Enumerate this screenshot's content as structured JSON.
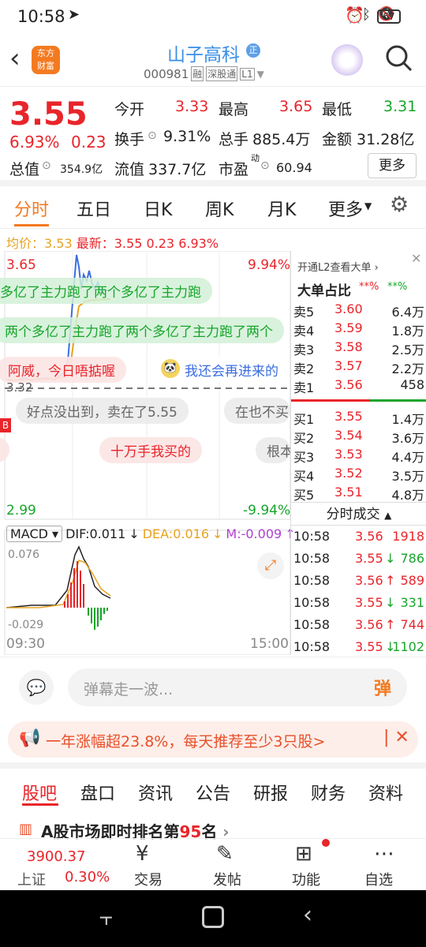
{
  "statusbar": {
    "time": "10:58",
    "battery": "67"
  },
  "header": {
    "title": "山子高科",
    "title_badge": "正",
    "code": "000981",
    "tags": [
      "融",
      "深股通",
      "L1"
    ]
  },
  "quote": {
    "price": "3.55",
    "change_pct": "6.93%",
    "change": "0.23",
    "open_label": "今开",
    "open": "3.33",
    "high_label": "最高",
    "high": "3.65",
    "low_label": "最低",
    "low": "3.31",
    "turnover_label": "换手",
    "turnover": "9.31%",
    "volume_label": "总手",
    "volume": "885.4万",
    "amount_label": "金额",
    "amount": "31.28亿",
    "mcap_label": "总值",
    "mcap": "354.9亿",
    "float_label": "流值",
    "float": "337.7亿",
    "pe_label": "市盈",
    "pe_sup": "动",
    "pe": "60.94",
    "more": "更多"
  },
  "tabs": [
    "分时",
    "五日",
    "日K",
    "周K",
    "月K",
    "更多"
  ],
  "chart": {
    "avg_label": "均价：",
    "avg": "3.53",
    "latest_label": "最新：",
    "latest": "3.55",
    "latest_chg": "0.23",
    "latest_pct": "6.93%",
    "top_price": "3.65",
    "top_pct": "9.94%",
    "bot_price": "2.99",
    "bot_pct": "-9.94%",
    "pre_close": "3.32",
    "macd_label": "MACD",
    "dif": "DIF:0.011",
    "dea": "DEA:0.016",
    "m": "M:-0.009",
    "macd_top": "0.076",
    "macd_bot": "-0.029",
    "t_start": "09:30",
    "t_end": "15:00"
  },
  "danmu": [
    "多亿了主力跑了两个多亿了主力跑",
    "两个多亿了主力跑了两个多亿了主力跑了两个",
    "阿威，今日唔掂喔",
    "我还会再进来的",
    "好点没出到，卖在了5.55",
    "在也不买",
    "十万手我买的",
    "根本"
  ],
  "side": {
    "l2": "开通L2查看大单",
    "big_label": "大单占比",
    "big_a": "**%",
    "big_b": "**%",
    "asks": [
      {
        "l": "卖5",
        "p": "3.60",
        "v": "6.4万"
      },
      {
        "l": "卖4",
        "p": "3.59",
        "v": "1.8万"
      },
      {
        "l": "卖3",
        "p": "3.58",
        "v": "2.5万"
      },
      {
        "l": "卖2",
        "p": "3.57",
        "v": "2.2万"
      },
      {
        "l": "卖1",
        "p": "3.56",
        "v": "458"
      }
    ],
    "bids": [
      {
        "l": "买1",
        "p": "3.55",
        "v": "1.4万"
      },
      {
        "l": "买2",
        "p": "3.54",
        "v": "3.6万"
      },
      {
        "l": "买3",
        "p": "3.53",
        "v": "4.4万"
      },
      {
        "l": "买4",
        "p": "3.52",
        "v": "3.5万"
      },
      {
        "l": "买5",
        "p": "3.51",
        "v": "4.8万"
      }
    ],
    "ticks_label": "分时成交",
    "ticks": [
      {
        "t": "10:58",
        "p": "3.56",
        "v": "1918",
        "c": "red",
        "a": ""
      },
      {
        "t": "10:58",
        "p": "3.55",
        "v": "786",
        "c": "green",
        "a": "↓"
      },
      {
        "t": "10:58",
        "p": "3.56",
        "v": "589",
        "c": "red",
        "a": "↑"
      },
      {
        "t": "10:58",
        "p": "3.55",
        "v": "331",
        "c": "green",
        "a": "↓"
      },
      {
        "t": "10:58",
        "p": "3.56",
        "v": "744",
        "c": "red",
        "a": "↑"
      },
      {
        "t": "10:58",
        "p": "3.55",
        "v": "1102",
        "c": "green",
        "a": "↓"
      }
    ]
  },
  "comment": {
    "placeholder": "弹幕走一波...",
    "btn": "弹"
  },
  "promo": {
    "text": "一年涨幅超23.8%，每天推荐至少3只股>"
  },
  "bottabs": [
    "股吧",
    "盘口",
    "资讯",
    "公告",
    "研报",
    "财务",
    "资料"
  ],
  "rank": {
    "text_a": "A股市场即时排名第",
    "num": "95",
    "text_b": "名"
  },
  "botnav": {
    "index_val": "3900.37",
    "index_name": "上证",
    "index_pct": "0.30%",
    "items": [
      "交易",
      "发帖",
      "功能",
      "自选"
    ]
  }
}
